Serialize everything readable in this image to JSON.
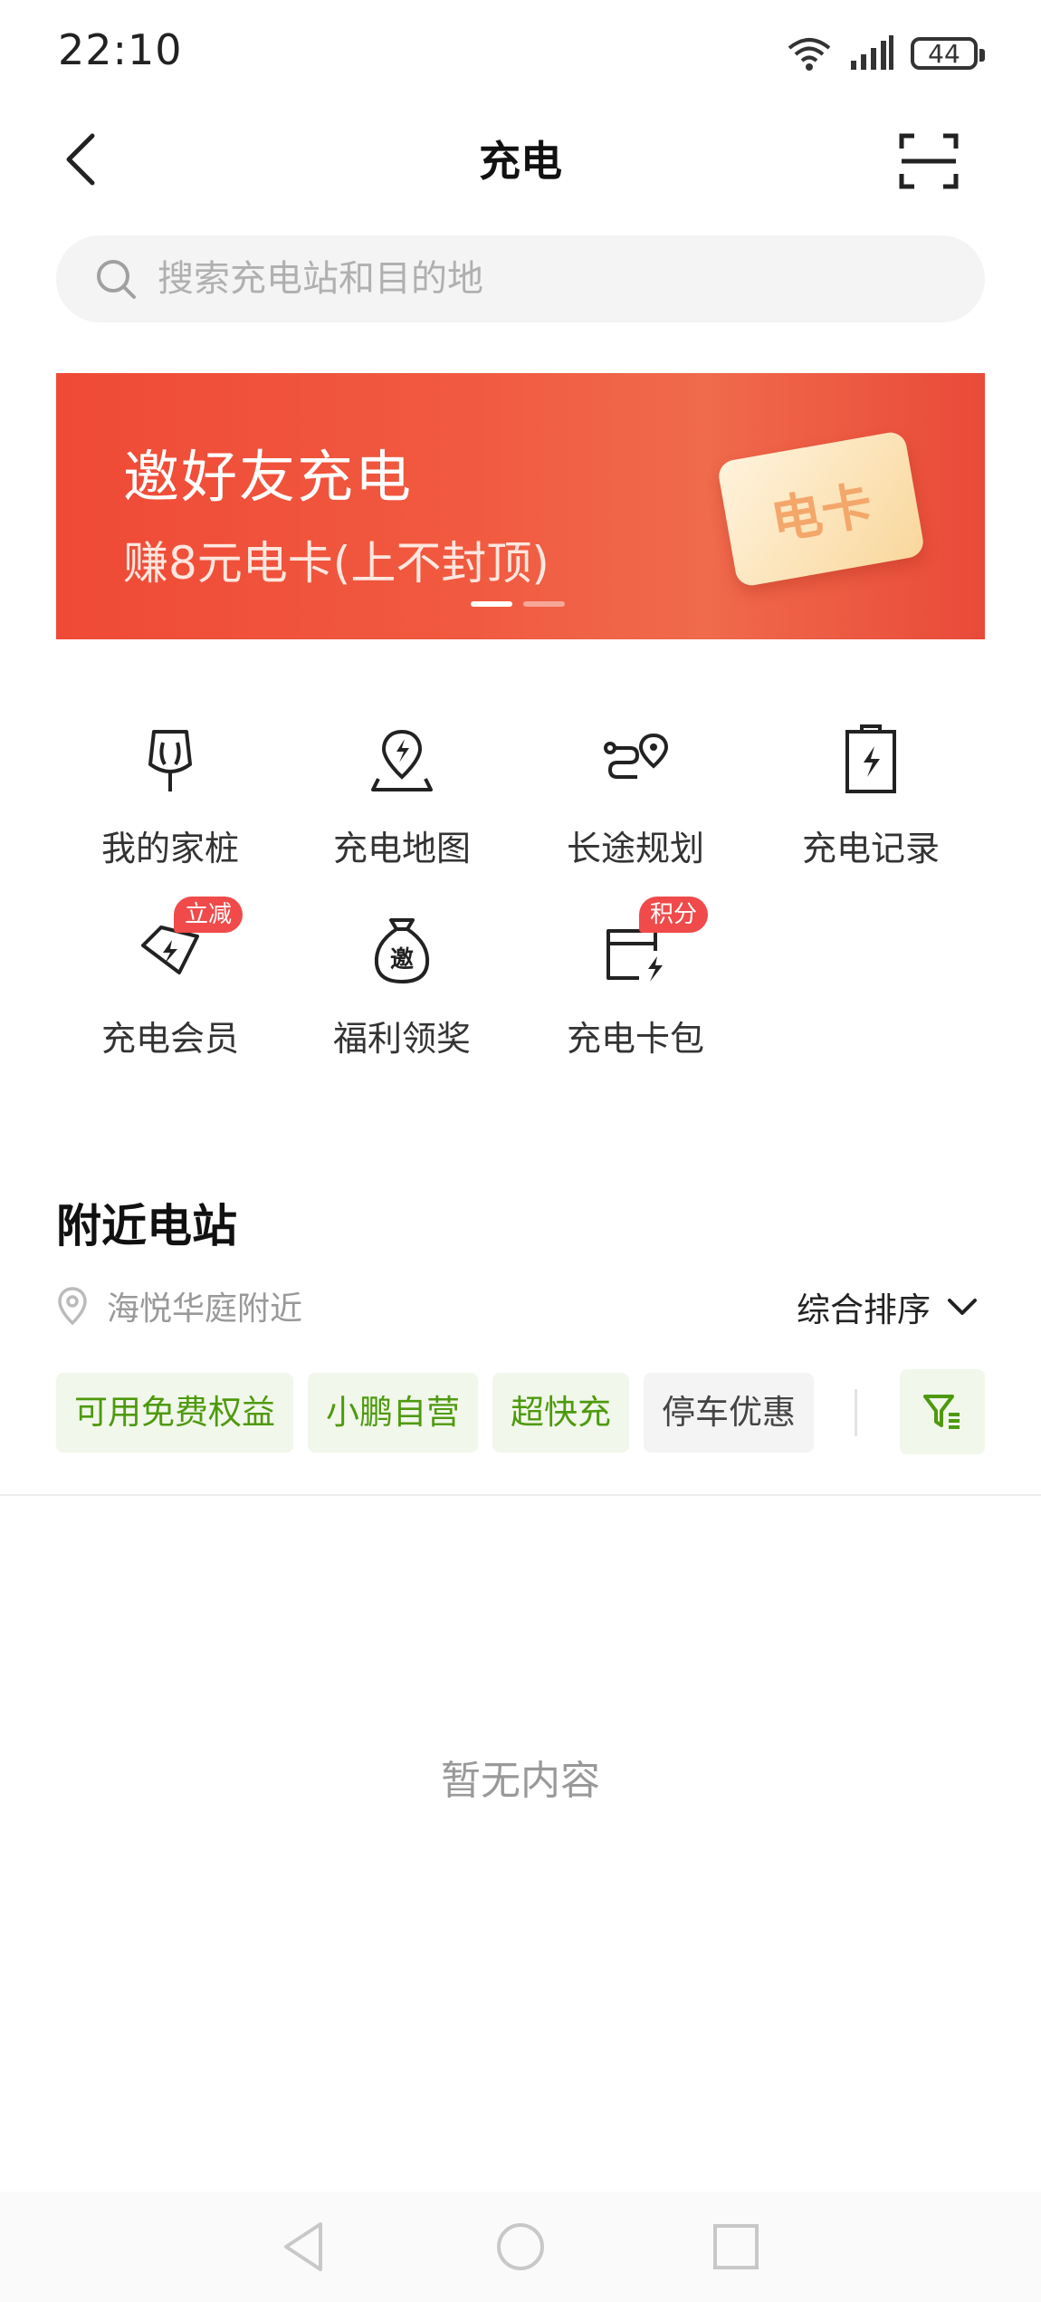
{
  "status_bar": {
    "time": "22:10",
    "battery": "44"
  },
  "nav": {
    "title": "充电"
  },
  "search": {
    "placeholder": "搜索充电站和目的地"
  },
  "banner": {
    "title": "邀好友充电",
    "subtitle": "赚8元电卡(上不封顶)",
    "card_text": "电卡"
  },
  "grid": [
    {
      "label": "我的家桩",
      "icon": "home-charger-icon"
    },
    {
      "label": "充电地图",
      "icon": "charge-map-icon"
    },
    {
      "label": "长途规划",
      "icon": "route-plan-icon"
    },
    {
      "label": "充电记录",
      "icon": "charge-record-icon"
    },
    {
      "label": "充电会员",
      "icon": "member-icon",
      "badge": "立减"
    },
    {
      "label": "福利领奖",
      "icon": "reward-bag-icon",
      "glyph": "邀"
    },
    {
      "label": "充电卡包",
      "icon": "card-wallet-icon",
      "badge": "积分"
    }
  ],
  "nearby": {
    "title": "附近电站",
    "location": "海悦华庭附近",
    "sort_label": "综合排序",
    "chips": [
      "可用免费权益",
      "小鹏自营",
      "超快充",
      "停车优惠"
    ],
    "empty_text": "暂无内容"
  },
  "colors": {
    "accent_green": "#4e9a0e",
    "banner_red": "#ef4a36",
    "badge_red": "#f04a4a"
  }
}
